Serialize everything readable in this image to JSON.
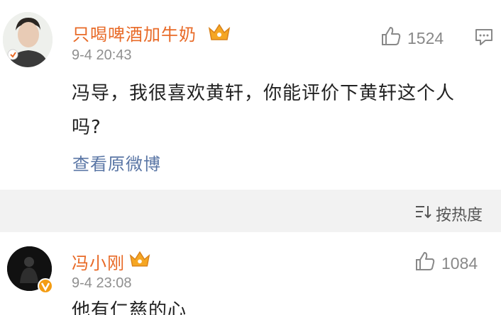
{
  "post": {
    "username": "只喝啤酒加牛奶",
    "time": "9-4 20:43",
    "like_count": "1524",
    "text": "冯导，我很喜欢黄轩，你能评价下黄轩这个人吗?",
    "view_original": "查看原微博"
  },
  "sort": {
    "label": "按热度"
  },
  "reply": {
    "username": "冯小刚",
    "time": "9-4 23:08",
    "like_count": "1084",
    "text": "他有仁慈的心"
  },
  "colors": {
    "username": "#e86a27",
    "link": "#5a76a5",
    "crown": "#f5a623",
    "verified_badge": "#f39c12"
  },
  "icons": [
    "crown-icon",
    "thumbs-up-icon",
    "comment-icon",
    "sort-icon",
    "verified-badge-icon"
  ]
}
